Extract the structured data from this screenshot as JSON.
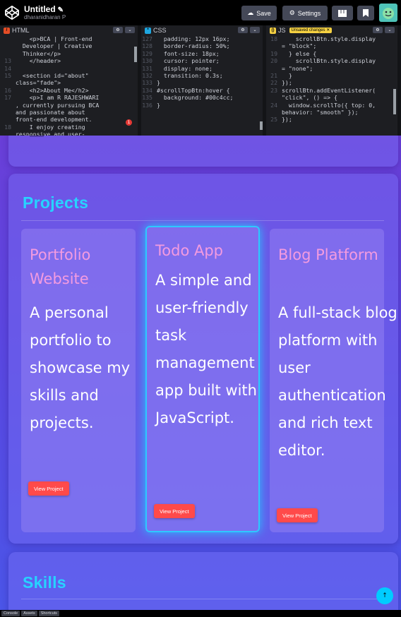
{
  "app": {
    "title": "Untitled",
    "owner": "dharanidharan P",
    "save_label": "Save",
    "settings_label": "Settings"
  },
  "editors": {
    "html": {
      "label": "HTML",
      "lines": [
        {
          "n": "",
          "t": "    <p>BCA | Front-end"
        },
        {
          "n": "",
          "t": "  Developer | Creative"
        },
        {
          "n": "",
          "t": "  Thinker</p>"
        },
        {
          "n": "13",
          "t": "    </header>"
        },
        {
          "n": "14",
          "t": ""
        },
        {
          "n": "15",
          "t": "  <section id=\"about\""
        },
        {
          "n": "",
          "t": "class=\"fade\">"
        },
        {
          "n": "16",
          "t": "    <h2>About Me</h2>"
        },
        {
          "n": "17",
          "t": "    <p>I am R RAJESHWARI"
        },
        {
          "n": "",
          "t": ", currently pursuing BCA"
        },
        {
          "n": "",
          "t": "and passionate about"
        },
        {
          "n": "",
          "t": "front-end development."
        },
        {
          "n": "18",
          "t": "    I enjoy creating"
        },
        {
          "n": "",
          "t": "responsive and user-"
        }
      ],
      "error_count": "1"
    },
    "css": {
      "label": "CSS",
      "lines": [
        {
          "n": "127",
          "t": "  padding: 12px 16px;"
        },
        {
          "n": "128",
          "t": "  border-radius: 50%;"
        },
        {
          "n": "129",
          "t": "  font-size: 18px;"
        },
        {
          "n": "130",
          "t": "  cursor: pointer;"
        },
        {
          "n": "131",
          "t": "  display: none;"
        },
        {
          "n": "132",
          "t": "  transition: 0.3s;"
        },
        {
          "n": "133",
          "t": "}"
        },
        {
          "n": "134",
          "t": "#scrollTopBtn:hover {"
        },
        {
          "n": "135",
          "t": "  background: #00c4cc;"
        },
        {
          "n": "136",
          "t": "}"
        }
      ]
    },
    "js": {
      "label": "JS",
      "unsaved_label": "Unsaved changes",
      "lines": [
        {
          "n": "18",
          "t": "    scrollBtn.style.display"
        },
        {
          "n": "",
          "t": "= \"block\";"
        },
        {
          "n": "19",
          "t": "  } else {"
        },
        {
          "n": "20",
          "t": "    scrollBtn.style.display"
        },
        {
          "n": "",
          "t": "= \"none\";"
        },
        {
          "n": "21",
          "t": "  }"
        },
        {
          "n": "22",
          "t": "});"
        },
        {
          "n": "23",
          "t": "scrollBtn.addEventListener("
        },
        {
          "n": "",
          "t": "\"click\", () => {"
        },
        {
          "n": "24",
          "t": "  window.scrollTo({ top: 0,"
        },
        {
          "n": "",
          "t": "behavior: \"smooth\" });"
        },
        {
          "n": "25",
          "t": "});"
        }
      ]
    }
  },
  "preview": {
    "projects": {
      "title": "Projects",
      "cards": [
        {
          "title": "Portfolio Website",
          "desc": "A personal portfolio to showcase my skills and projects.",
          "button": "View Project"
        },
        {
          "title": "Todo App",
          "desc": "A simple and user-friendly task management app built with JavaScript.",
          "button": "View Project"
        },
        {
          "title": "Blog Platform",
          "desc": "A full-stack blog platform with user authentication and rich text editor.",
          "button": "View Project"
        }
      ]
    },
    "skills": {
      "title": "Skills"
    },
    "scroll_top_glyph": "↑"
  },
  "bottombar": {
    "console": "Console",
    "assets": "Assets",
    "shortcuts": "Shortcuts"
  },
  "colors": {
    "accent_cyan": "#27d3ff",
    "card_title_pink": "#f39be0",
    "button_red": "#ff4a4a"
  }
}
